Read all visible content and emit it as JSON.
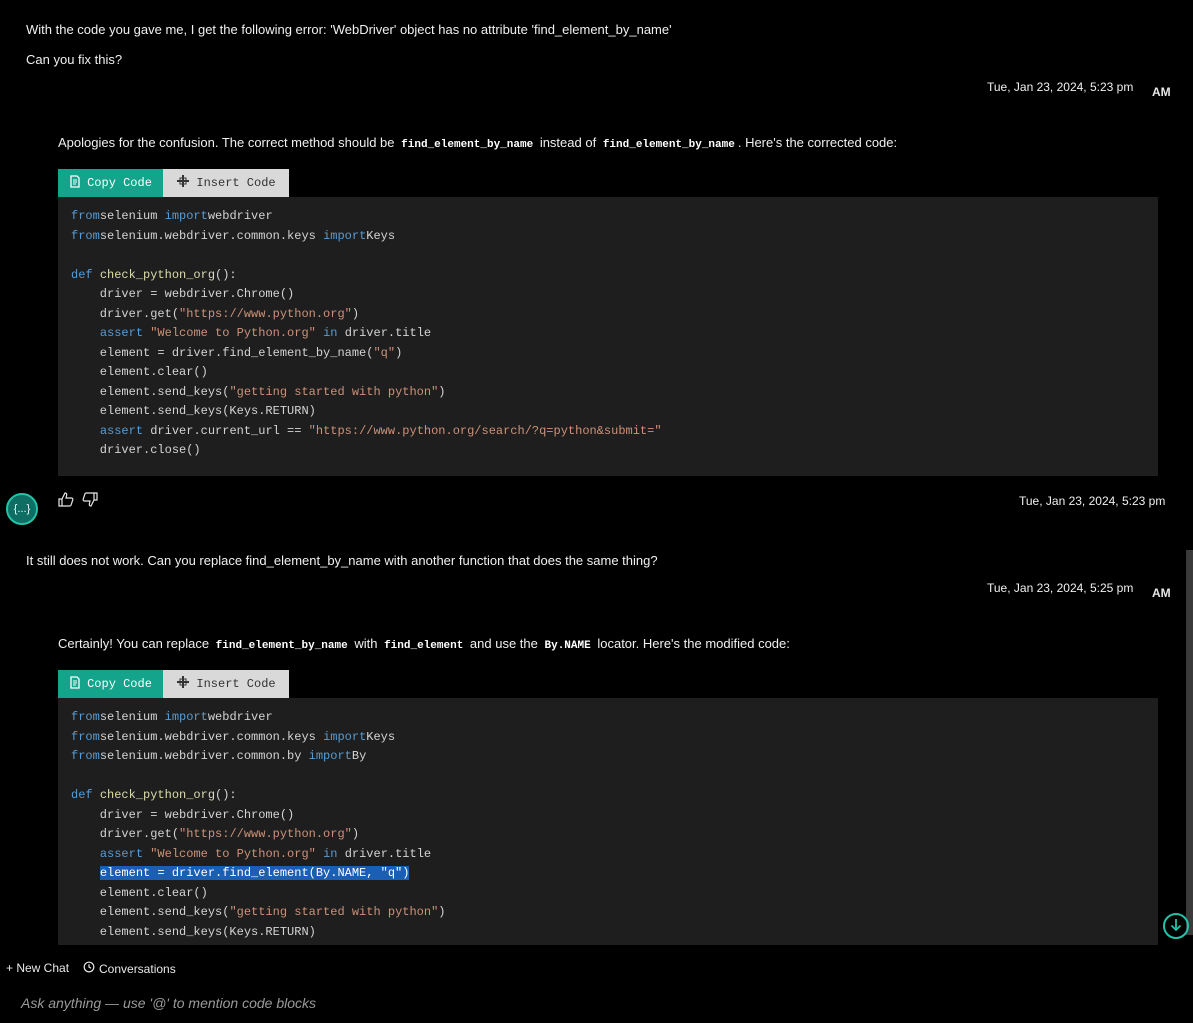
{
  "conversation": {
    "msg1": {
      "line1": "With the code you gave me, I get the following error:  'WebDriver' object has no attribute 'find_element_by_name'",
      "line2": "Can you fix this?",
      "timestamp": "Tue, Jan 23, 2024, 5:23 pm",
      "avatar_label": "AM"
    },
    "reply1": {
      "text_a": "Apologies for the confusion. The correct method should be",
      "code_a": "find_element_by_name",
      "text_b": "instead of",
      "code_b": "find_element_by_name",
      "text_c": ". Here's the corrected code:",
      "copy_label": "Copy Code",
      "insert_label": "Insert Code",
      "timestamp": "Tue, Jan 23, 2024, 5:23 pm",
      "avatar_label": "{...}"
    },
    "msg2": {
      "line1": "It still does not work. Can you replace find_element_by_name with another function that does the same thing?",
      "timestamp": "Tue, Jan 23, 2024, 5:25 pm",
      "avatar_label": "AM"
    },
    "reply2": {
      "text_a": "Certainly! You can replace",
      "code_a": "find_element_by_name",
      "text_b": "with",
      "code_b": "find_element",
      "text_c": "and use the",
      "code_c": "By.NAME",
      "text_d": "locator. Here's the modified code:",
      "copy_label": "Copy Code",
      "insert_label": "Insert Code"
    }
  },
  "code1": [
    [
      [
        "kw",
        "from"
      ],
      [
        "",
        "selenium "
      ],
      [
        "kw",
        "import"
      ],
      [
        "",
        "webdriver"
      ]
    ],
    [
      [
        "kw",
        "from"
      ],
      [
        "",
        "selenium.webdriver.common.keys "
      ],
      [
        "kw",
        "import"
      ],
      [
        "",
        "Keys"
      ]
    ],
    [],
    [
      [
        "kw",
        "def "
      ],
      [
        "fn",
        "check_python_org"
      ],
      [
        "",
        "():"
      ]
    ],
    [
      [
        "",
        "    driver = webdriver.Chrome()"
      ]
    ],
    [
      [
        "",
        "    driver.get("
      ],
      [
        "str",
        "\"https://www.python.org\""
      ],
      [
        "",
        ")"
      ]
    ],
    [
      [
        "",
        "    "
      ],
      [
        "kw",
        "assert "
      ],
      [
        "str",
        "\"Welcome to Python.org\""
      ],
      [
        "kw",
        " in "
      ],
      [
        "",
        "driver.title"
      ]
    ],
    [
      [
        "",
        "    element = driver.find_element_by_name("
      ],
      [
        "str",
        "\"q\""
      ],
      [
        "",
        ")"
      ]
    ],
    [
      [
        "",
        "    element.clear()"
      ]
    ],
    [
      [
        "",
        "    element.send_keys("
      ],
      [
        "str",
        "\"getting started with python\""
      ],
      [
        "",
        ")"
      ]
    ],
    [
      [
        "",
        "    element.send_keys(Keys.RETURN)"
      ]
    ],
    [
      [
        "",
        "    "
      ],
      [
        "kw",
        "assert "
      ],
      [
        "",
        "driver.current_url == "
      ],
      [
        "str",
        "\"https://www.python.org/search/?q=python&submit=\""
      ]
    ],
    [
      [
        "",
        "    driver.close()"
      ]
    ]
  ],
  "code2": [
    [
      [
        "kw",
        "from"
      ],
      [
        "",
        "selenium "
      ],
      [
        "kw",
        "import"
      ],
      [
        "",
        "webdriver"
      ]
    ],
    [
      [
        "kw",
        "from"
      ],
      [
        "",
        "selenium.webdriver.common.keys "
      ],
      [
        "kw",
        "import"
      ],
      [
        "",
        "Keys"
      ]
    ],
    [
      [
        "kw",
        "from"
      ],
      [
        "",
        "selenium.webdriver.common.by "
      ],
      [
        "kw",
        "import"
      ],
      [
        "",
        "By"
      ]
    ],
    [],
    [
      [
        "kw",
        "def "
      ],
      [
        "fn",
        "check_python_org"
      ],
      [
        "",
        "():"
      ]
    ],
    [
      [
        "",
        "    driver = webdriver.Chrome()"
      ]
    ],
    [
      [
        "",
        "    driver.get("
      ],
      [
        "str",
        "\"https://www.python.org\""
      ],
      [
        "",
        ")"
      ]
    ],
    [
      [
        "",
        "    "
      ],
      [
        "kw",
        "assert "
      ],
      [
        "str",
        "\"Welcome to Python.org\""
      ],
      [
        "kw",
        " in "
      ],
      [
        "",
        "driver.title"
      ]
    ],
    [
      [
        "",
        "    "
      ],
      [
        "sel",
        "element = driver.find_element(By.NAME, \"q\")"
      ]
    ],
    [
      [
        "",
        "    element.clear()"
      ]
    ],
    [
      [
        "",
        "    element.send_keys("
      ],
      [
        "str",
        "\"getting started with python\""
      ],
      [
        "",
        ")"
      ]
    ],
    [
      [
        "",
        "    element.send_keys(Keys.RETURN)"
      ]
    ]
  ],
  "bottom": {
    "new_chat": "+ New Chat",
    "conversations": "Conversations",
    "input_placeholder": "Ask anything — use '@' to mention code blocks"
  },
  "colors": {
    "accent": "#14a38b",
    "keyword": "#569cd6",
    "string": "#ce9178",
    "function": "#dcdcaa",
    "selection": "#1a5fb4"
  },
  "icons": [
    "copy-icon",
    "insert-plus-icon",
    "thumbs-up-icon",
    "thumbs-down-icon",
    "history-icon",
    "arrow-down-icon"
  ]
}
